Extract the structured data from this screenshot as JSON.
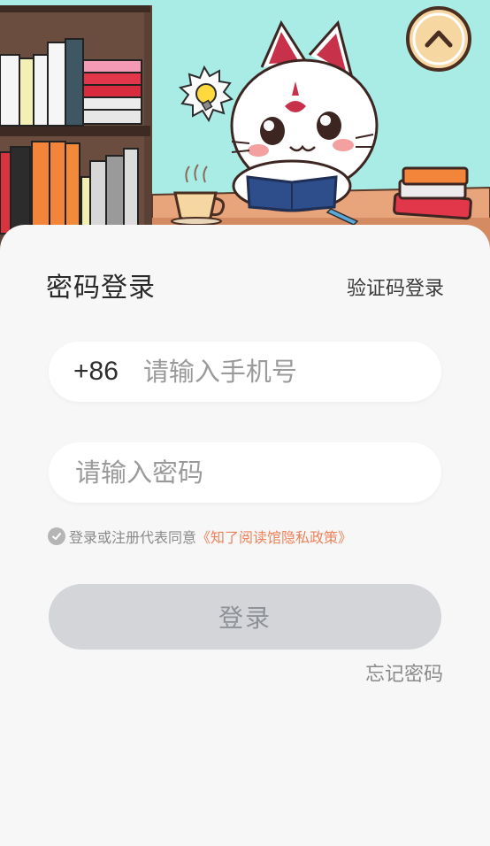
{
  "header": {
    "illustration_icon": "cat-reading-book-illustration",
    "collapse_icon": "chevron-up-icon"
  },
  "login": {
    "title": "密码登录",
    "switch_label": "验证码登录",
    "phone": {
      "prefix": "+86",
      "placeholder": "请输入手机号",
      "value": ""
    },
    "password": {
      "placeholder": "请输入密码",
      "value": ""
    },
    "agreement": {
      "checked": true,
      "text": "登录或注册代表同意",
      "link_text": "《知了阅读馆隐私政策》"
    },
    "submit_label": "登录",
    "forgot_label": "忘记密码"
  },
  "colors": {
    "hero_background": "#a9ece6",
    "sheet_background": "#f7f7f7",
    "link_accent": "#f0825a",
    "disabled_button": "#d3d5d8"
  }
}
